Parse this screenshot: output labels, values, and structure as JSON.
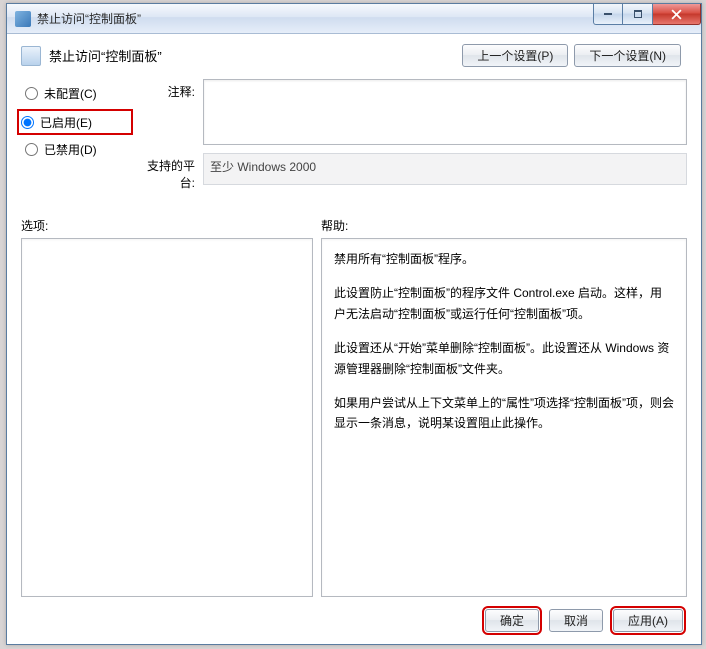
{
  "window": {
    "title": "禁止访问“控制面板”"
  },
  "header": {
    "title": "禁止访问“控制面板”",
    "prev_btn": "上一个设置(P)",
    "next_btn": "下一个设置(N)"
  },
  "radios": {
    "not_configured": "未配置(C)",
    "enabled": "已启用(E)",
    "disabled": "已禁用(D)",
    "selected": "enabled"
  },
  "fields": {
    "comment_label": "注释:",
    "comment_value": "",
    "platform_label": "支持的平台:",
    "platform_value": "至少 Windows 2000"
  },
  "panes": {
    "options_label": "选项:",
    "help_label": "帮助:",
    "help_text": [
      "禁用所有“控制面板”程序。",
      "此设置防止“控制面板”的程序文件 Control.exe 启动。这样，用户无法启动“控制面板”或运行任何“控制面板”项。",
      "此设置还从“开始”菜单删除“控制面板”。此设置还从 Windows 资源管理器删除“控制面板”文件夹。",
      "如果用户尝试从上下文菜单上的“属性”项选择“控制面板”项，则会显示一条消息，说明某设置阻止此操作。"
    ]
  },
  "footer": {
    "ok": "确定",
    "cancel": "取消",
    "apply": "应用(A)"
  }
}
